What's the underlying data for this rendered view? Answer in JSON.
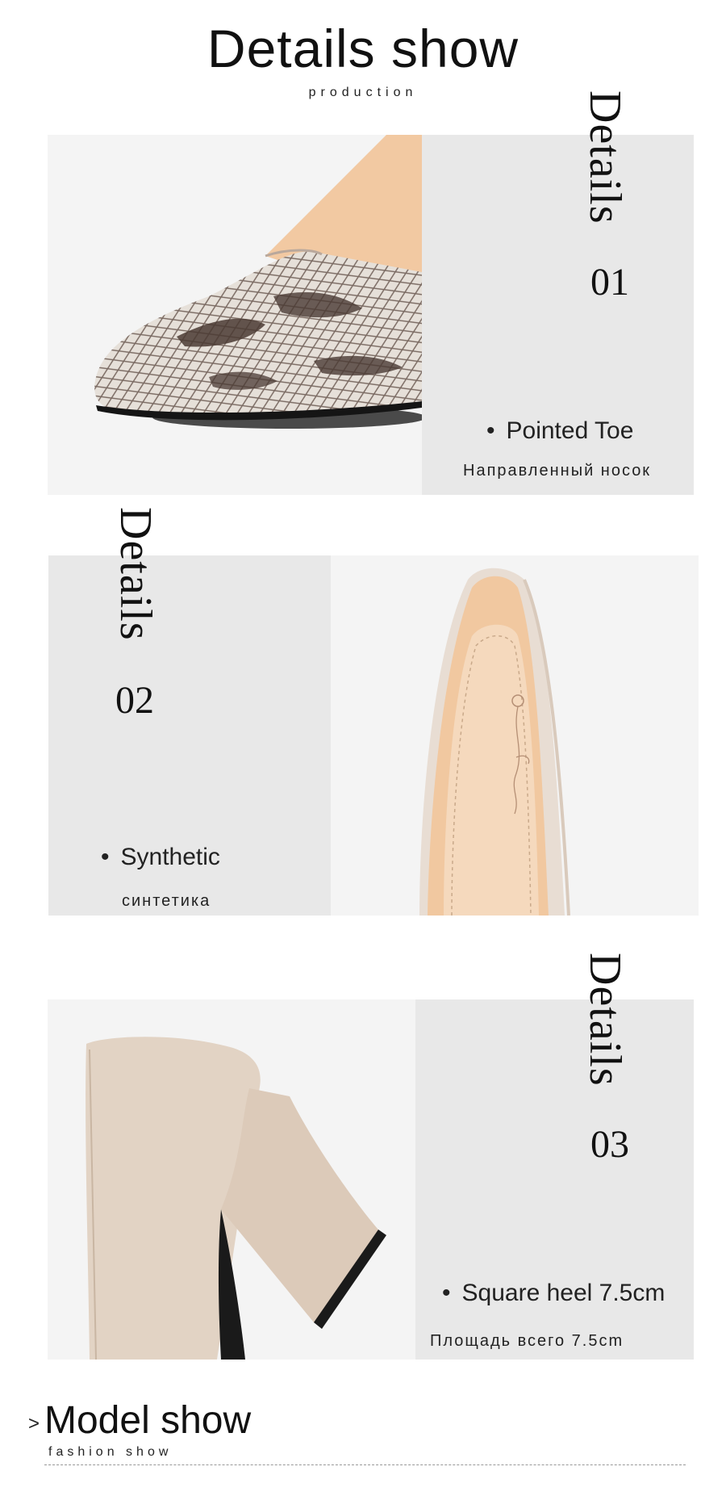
{
  "header": {
    "title": "Details show",
    "subtitle": "production"
  },
  "details": [
    {
      "word": "Details",
      "number": "01",
      "feature": "Pointed Toe",
      "feature_ru": "Направленный носок",
      "image": "snakeskin-pointed-toe-photo"
    },
    {
      "word": "Details",
      "number": "02",
      "feature": "Synthetic",
      "feature_ru": "синтетика",
      "image": "shoe-insole-photo"
    },
    {
      "word": "Details",
      "number": "03",
      "feature": "Square heel 7.5cm",
      "feature_ru": "Площадь всего 7.5cm",
      "image": "block-heel-photo"
    }
  ],
  "footer": {
    "arrow": ">",
    "title": "Model show",
    "subtitle": "fashion show"
  },
  "colors": {
    "panel_grey": "#e8e8e8",
    "photo_bg": "#f4f4f4",
    "snake_light": "#e6e0d9",
    "snake_dark": "#4a3a33",
    "lining": "#f2c9a2",
    "suede": "#e2d3c4"
  }
}
